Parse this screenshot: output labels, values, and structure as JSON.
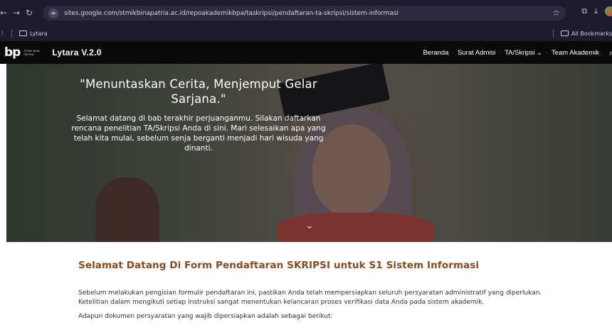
{
  "browser": {
    "url": "sites.google.com/stmikbinapatria.ac.id/repoakademikbpa/taskripsi/pendaftaran-ta-skripsi/sistem-informasi",
    "bookmark_folder": "Lytara",
    "all_bookmarks": "All Bookmarks",
    "icons": [
      "back-icon",
      "forward-icon",
      "reload-icon",
      "site-info-icon",
      "star-icon",
      "cast-icon",
      "download-icon",
      "profile-icon"
    ]
  },
  "site": {
    "logo_mark": "bp",
    "logo_caption": "STMIK BINA PATRIA",
    "title": "Lytara V.2.0",
    "menu": [
      "Beranda",
      "Surat Admisi",
      "TA/Skripsi",
      "Team Akademik"
    ],
    "dropdown_arrow": "⌄"
  },
  "hero": {
    "title": "\"Menuntaskan Cerita, Menjemput Gelar Sarjana.\"",
    "body": "Selamat datang di bab terakhir perjuanganmu. Silakan daftarkan rencana penelitian TA/Skripsi Anda di sini. Mari selesaikan apa yang telah kita mulai, sebelum senja berganti menjadi hari wisuda yang dinanti."
  },
  "content": {
    "heading": "Selamat Datang Di Form Pendaftaran SKRIPSI untuk S1 Sistem Informasi",
    "paragraph1": "Sebelum melakukan pengisian formulir pendaftaran ini, pastikan Anda telah mempersiapkan seluruh persyaratan administratif yang diperlukan. Ketelitian dalam mengikuti setiap instruksi sangat menentukan kelancaran proses verifikasi data Anda pada sistem akademik.",
    "paragraph2": "Adapun dokumen persyaratan yang wajib dipersiapkan adalah sebagai berikut:"
  },
  "colors": {
    "heading": "#8a4a1e",
    "nav_bg": "#0a0a0a",
    "chrome_bg": "#1f1b2e"
  }
}
